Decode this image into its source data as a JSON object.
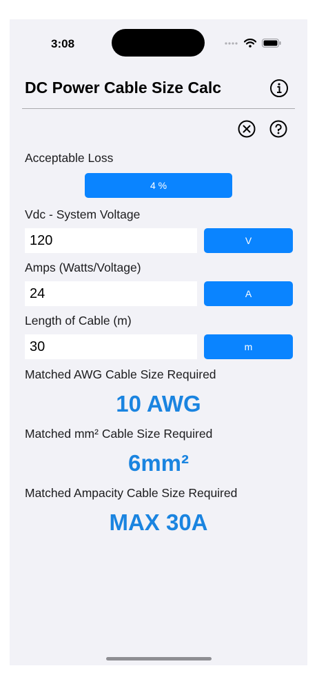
{
  "status": {
    "time": "3:08"
  },
  "header": {
    "title": "DC Power Cable Size Calc"
  },
  "loss": {
    "label": "Acceptable Loss",
    "button": "4 %"
  },
  "voltage": {
    "label": "Vdc - System Voltage",
    "value": "120",
    "unit_button": "V"
  },
  "amps": {
    "label": "Amps (Watts/Voltage)",
    "value": "24",
    "unit_button": "A"
  },
  "length": {
    "label": "Length of Cable (m)",
    "value": "30",
    "unit_button": "m"
  },
  "results": {
    "awg_label": "Matched AWG Cable Size Required",
    "awg_value": "10 AWG",
    "mm_label": "Matched mm² Cable Size Required",
    "mm_value": "6mm²",
    "amp_label": "Matched Ampacity Cable Size Required",
    "amp_value": "MAX 30A"
  },
  "colors": {
    "accent": "#0a84ff",
    "result": "#1a84e0",
    "background": "#f2f2f7"
  }
}
